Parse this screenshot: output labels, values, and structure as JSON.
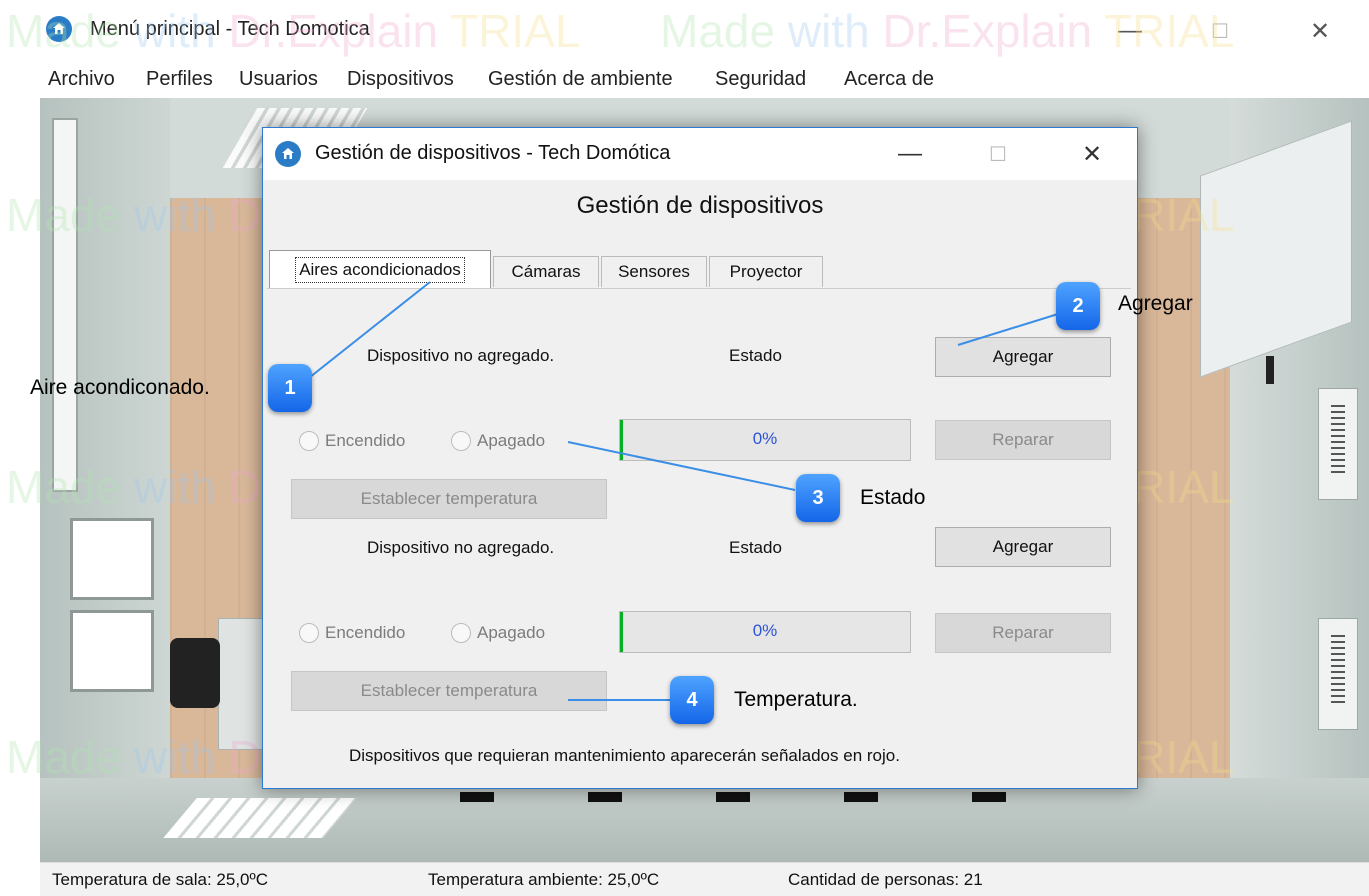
{
  "main_window": {
    "title": "Menú principal - Tech Domotica",
    "menu": [
      "Archivo",
      "Perfiles",
      "Usuarios",
      "Dispositivos",
      "Gestión de ambiente",
      "Seguridad",
      "Acerca de"
    ],
    "minimize": "—",
    "maximize": "☐",
    "close": "✕"
  },
  "statusbar": {
    "room_temp": "Temperatura de sala: 25,0ºC",
    "ambient_temp": "Temperatura ambiente: 25,0ºC",
    "people": "Cantidad de personas: 21"
  },
  "dialog": {
    "title": "Gestión de dispositivos - Tech Domótica",
    "heading": "Gestión de dispositivos",
    "minimize": "—",
    "maximize": "☐",
    "close": "✕",
    "tabs": [
      "Aires acondicionados",
      "Cámaras",
      "Sensores",
      "Proyector"
    ],
    "devices": [
      {
        "status_text": "Dispositivo no agregado.",
        "state_label": "Estado",
        "add_label": "Agregar",
        "on_label": "Encendido",
        "off_label": "Apagado",
        "progress_text": "0%",
        "progress_value": 0,
        "repair_label": "Reparar",
        "set_temp_label": "Establecer temperatura"
      },
      {
        "status_text": "Dispositivo no agregado.",
        "state_label": "Estado",
        "add_label": "Agregar",
        "on_label": "Encendido",
        "off_label": "Apagado",
        "progress_text": "0%",
        "progress_value": 0,
        "repair_label": "Reparar",
        "set_temp_label": "Establecer temperatura"
      }
    ],
    "footer": "Dispositivos que requieran mantenimiento aparecerán señalados en rojo."
  },
  "callouts": [
    {
      "number": "1",
      "text": "Aire acondiconado."
    },
    {
      "number": "2",
      "text": "Agregar"
    },
    {
      "number": "3",
      "text": "Estado"
    },
    {
      "number": "4",
      "text": "Temperatura."
    }
  ],
  "watermark": "Made with Dr.Explain TRIAL",
  "colors": {
    "accent": "#2b79d0",
    "callout": "#1e6fe8",
    "progress_fill": "#06b025",
    "progress_text": "#2c54d6"
  },
  "icons": {
    "app": "home-badge-icon"
  }
}
